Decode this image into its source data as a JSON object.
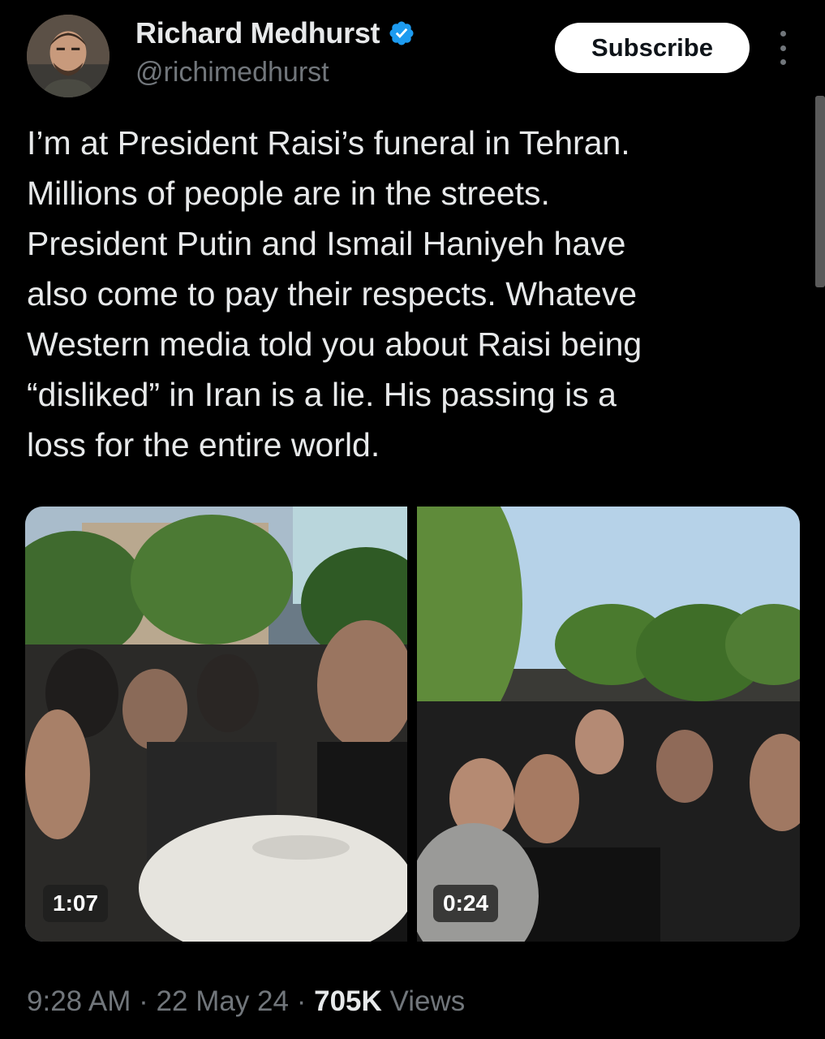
{
  "author": {
    "display_name": "Richard Medhurst",
    "handle": "@richimedhurst",
    "verified": true
  },
  "actions": {
    "subscribe_label": "Subscribe"
  },
  "tweet": {
    "text": "I’m at President Raisi’s funeral in Tehran.\nMillions of people are in the streets.\nPresident Putin and Ismail Haniyeh have\nalso come to pay their respects. Whateve\nWestern media told you about Raisi being\n“disliked” in Iran is a lie. His passing is a\nloss for the entire world."
  },
  "media": [
    {
      "type": "video",
      "duration": "1:07"
    },
    {
      "type": "video",
      "duration": "0:24"
    }
  ],
  "meta": {
    "time": "9:28 AM",
    "separator": "·",
    "date": "22 May 24",
    "views_count": "705K",
    "views_label": "Views"
  },
  "colors": {
    "background": "#000000",
    "text_primary": "#e7e9ea",
    "text_secondary": "#71767b",
    "verified_badge": "#1d9bf0"
  }
}
